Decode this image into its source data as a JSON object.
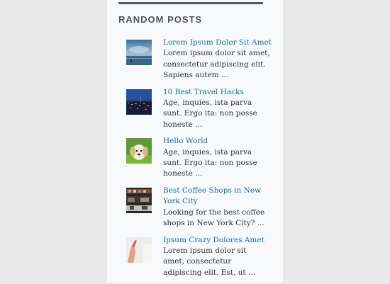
{
  "widget": {
    "title": "RANDOM POSTS"
  },
  "posts": [
    {
      "title": "Lorem Ipsum Dolor Sit Amet",
      "excerpt": "Lorem ipsum dolor sit amet, consectetur adipiscing elit. Sapiens autem ...",
      "thumbnail": "sea-landscape-thumbnail"
    },
    {
      "title": "10 Best Travel Hacks",
      "excerpt": "Age, inquies, ista parva sunt. Ergo ita: non posse honeste ...",
      "thumbnail": "night-city-thumbnail"
    },
    {
      "title": "Hello World",
      "excerpt": "Age, inquies, ista parva sunt. Ergo ita: non posse honeste ...",
      "thumbnail": "puppy-thumbnail"
    },
    {
      "title": "Best Coffee Shops in New York City",
      "excerpt": "Looking for the best coffee shops in New York City? ...",
      "thumbnail": "coffee-shop-thumbnail"
    },
    {
      "title": "Ipsum Crazy Dolores Amet",
      "excerpt": "Lorem ipsum dolor sit amet, consectetur adipiscing elit. Est, ut ...",
      "thumbnail": "hand-thumbnail"
    }
  ],
  "colors": {
    "link": "#1f6ba8",
    "text": "#333333",
    "heading": "#555555",
    "rule": "#5b5b5b",
    "panel": "#f8f9fb",
    "page": "#e9e9ea"
  }
}
